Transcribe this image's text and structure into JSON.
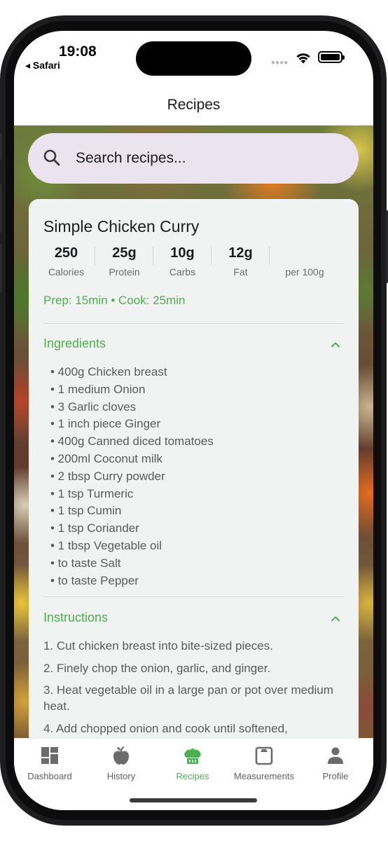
{
  "status_bar": {
    "time": "19:08",
    "back_app": "◂ Safari"
  },
  "header": {
    "title": "Recipes"
  },
  "search": {
    "placeholder": "Search recipes..."
  },
  "recipe": {
    "title": "Simple Chicken Curry",
    "macros": [
      {
        "value": "250",
        "label": "Calories"
      },
      {
        "value": "25g",
        "label": "Protein"
      },
      {
        "value": "10g",
        "label": "Carbs"
      },
      {
        "value": "12g",
        "label": "Fat"
      }
    ],
    "per_label": "per 100g",
    "timing": "Prep: 15min • Cook: 25min",
    "ingredients_title": "Ingredients",
    "ingredients": [
      "• 400g Chicken breast",
      "• 1 medium Onion",
      "• 3 Garlic cloves",
      "• 1 inch piece Ginger",
      "• 400g Canned diced tomatoes",
      "• 200ml Coconut milk",
      "• 2 tbsp Curry powder",
      "• 1 tsp Turmeric",
      "• 1 tsp Cumin",
      "• 1 tsp Coriander",
      "• 1 tbsp Vegetable oil",
      "• to taste Salt",
      "• to taste Pepper"
    ],
    "instructions_title": "Instructions",
    "instructions": [
      "1. Cut chicken breast into bite-sized pieces.",
      "2. Finely chop the onion, garlic, and ginger.",
      "3. Heat vegetable oil in a large pan or pot over medium heat.",
      "4. Add chopped onion and cook until softened,"
    ]
  },
  "tabbar": {
    "tabs": [
      {
        "label": "Dashboard",
        "icon": "dashboard-icon",
        "active": false
      },
      {
        "label": "History",
        "icon": "apple-icon",
        "active": false
      },
      {
        "label": "Recipes",
        "icon": "chef-hat-icon",
        "active": true
      },
      {
        "label": "Measurements",
        "icon": "scale-icon",
        "active": false
      },
      {
        "label": "Profile",
        "icon": "person-icon",
        "active": false
      }
    ]
  },
  "colors": {
    "accent": "#4caf50",
    "search_bg": "#ebe3f0",
    "card_bg": "#f1f3f2"
  }
}
